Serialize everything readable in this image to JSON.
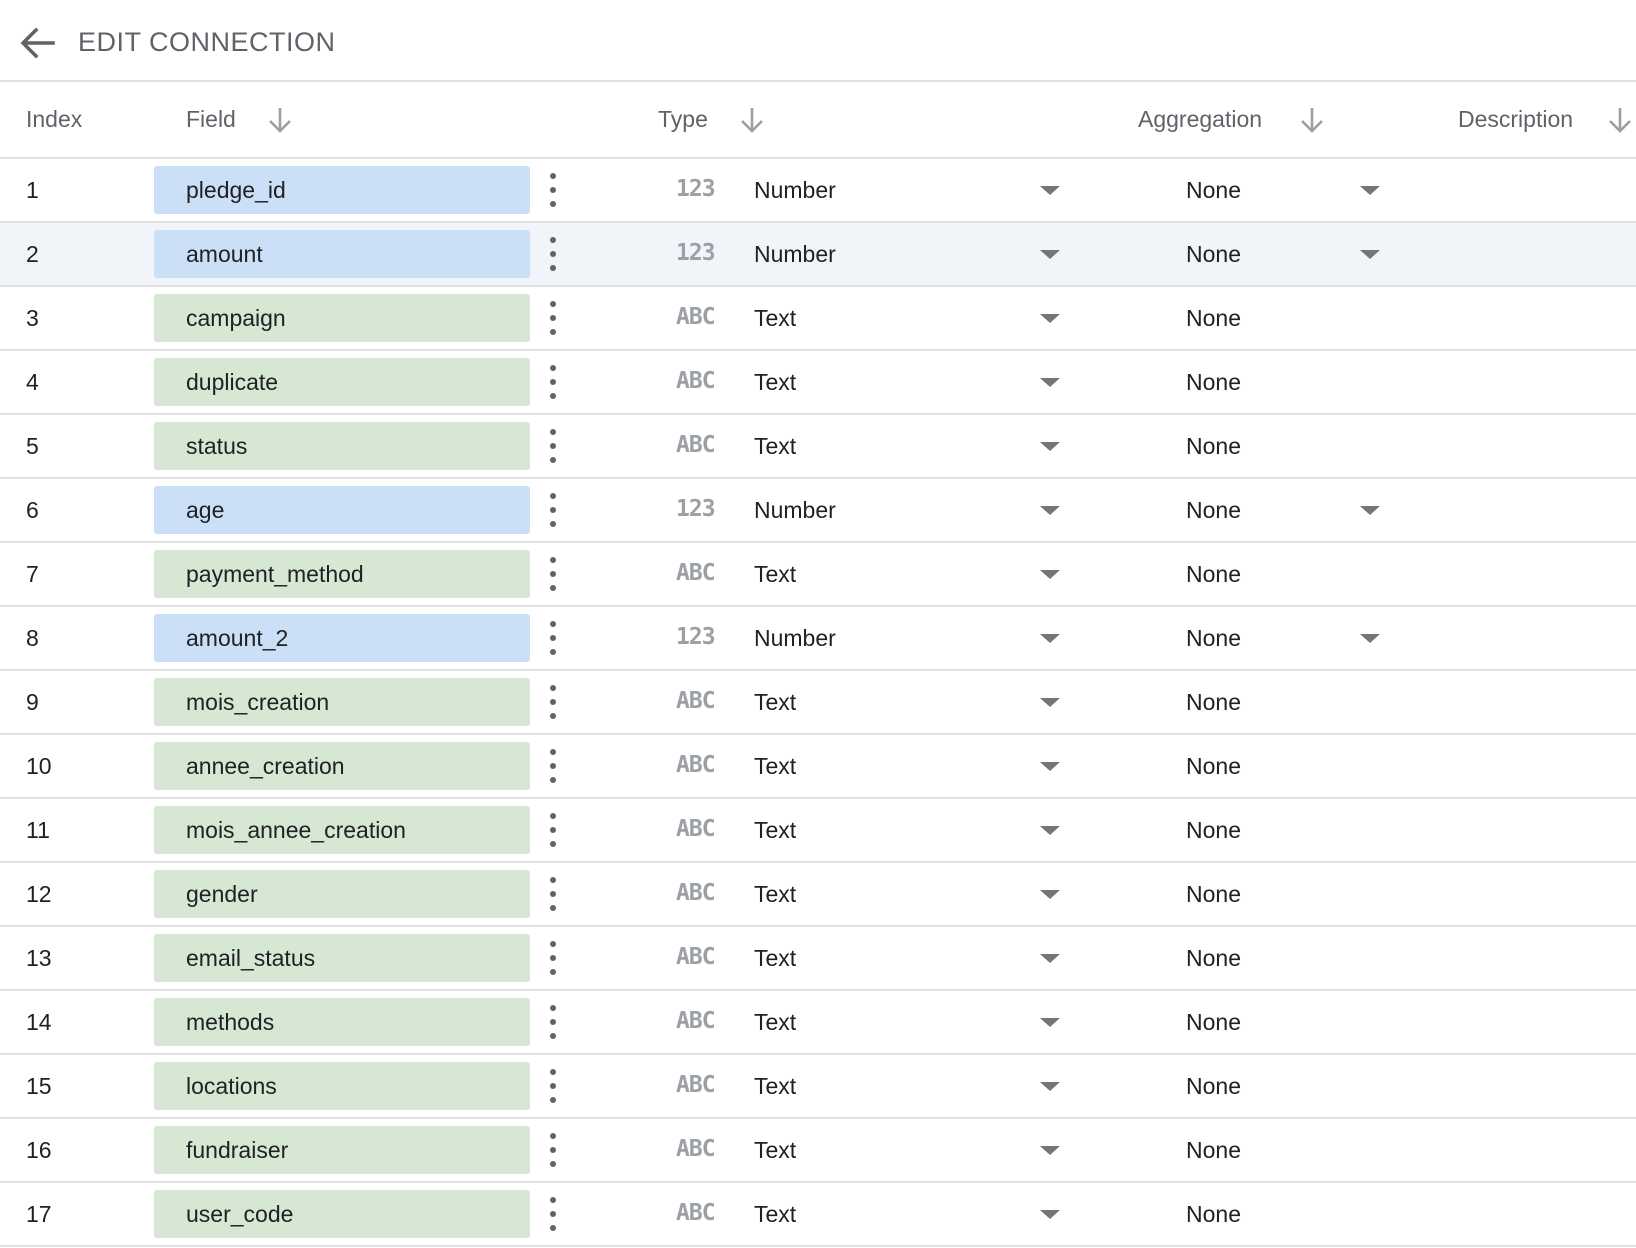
{
  "header": {
    "back_icon": "arrow-left-icon",
    "title": "EDIT CONNECTION"
  },
  "columns": {
    "index": "Index",
    "field": "Field",
    "type": "Type",
    "aggregation": "Aggregation",
    "description": "Description"
  },
  "icons": {
    "number_type": "123",
    "text_type": "ABC",
    "sort": "arrow-down-icon",
    "more": "more-vert-icon",
    "dropdown": "triangle-down-icon"
  },
  "colors": {
    "number_chip": "#cbe0f7",
    "text_chip": "#d6e8d3",
    "highlight_row": "#f1f5f9"
  },
  "rows": [
    {
      "index": "1",
      "field": "pledge_id",
      "kind": "number",
      "type": "Number",
      "aggregation": "None"
    },
    {
      "index": "2",
      "field": "amount",
      "kind": "number",
      "type": "Number",
      "aggregation": "None"
    },
    {
      "index": "3",
      "field": "campaign",
      "kind": "text",
      "type": "Text",
      "aggregation": "None"
    },
    {
      "index": "4",
      "field": "duplicate",
      "kind": "text",
      "type": "Text",
      "aggregation": "None"
    },
    {
      "index": "5",
      "field": "status",
      "kind": "text",
      "type": "Text",
      "aggregation": "None"
    },
    {
      "index": "6",
      "field": "age",
      "kind": "number",
      "type": "Number",
      "aggregation": "None"
    },
    {
      "index": "7",
      "field": "payment_method",
      "kind": "text",
      "type": "Text",
      "aggregation": "None"
    },
    {
      "index": "8",
      "field": "amount_2",
      "kind": "number",
      "type": "Number",
      "aggregation": "None"
    },
    {
      "index": "9",
      "field": "mois_creation",
      "kind": "text",
      "type": "Text",
      "aggregation": "None"
    },
    {
      "index": "10",
      "field": "annee_creation",
      "kind": "text",
      "type": "Text",
      "aggregation": "None"
    },
    {
      "index": "11",
      "field": "mois_annee_creation",
      "kind": "text",
      "type": "Text",
      "aggregation": "None"
    },
    {
      "index": "12",
      "field": "gender",
      "kind": "text",
      "type": "Text",
      "aggregation": "None"
    },
    {
      "index": "13",
      "field": "email_status",
      "kind": "text",
      "type": "Text",
      "aggregation": "None"
    },
    {
      "index": "14",
      "field": "methods",
      "kind": "text",
      "type": "Text",
      "aggregation": "None"
    },
    {
      "index": "15",
      "field": "locations",
      "kind": "text",
      "type": "Text",
      "aggregation": "None"
    },
    {
      "index": "16",
      "field": "fundraiser",
      "kind": "text",
      "type": "Text",
      "aggregation": "None"
    },
    {
      "index": "17",
      "field": "user_code",
      "kind": "text",
      "type": "Text",
      "aggregation": "None"
    }
  ]
}
